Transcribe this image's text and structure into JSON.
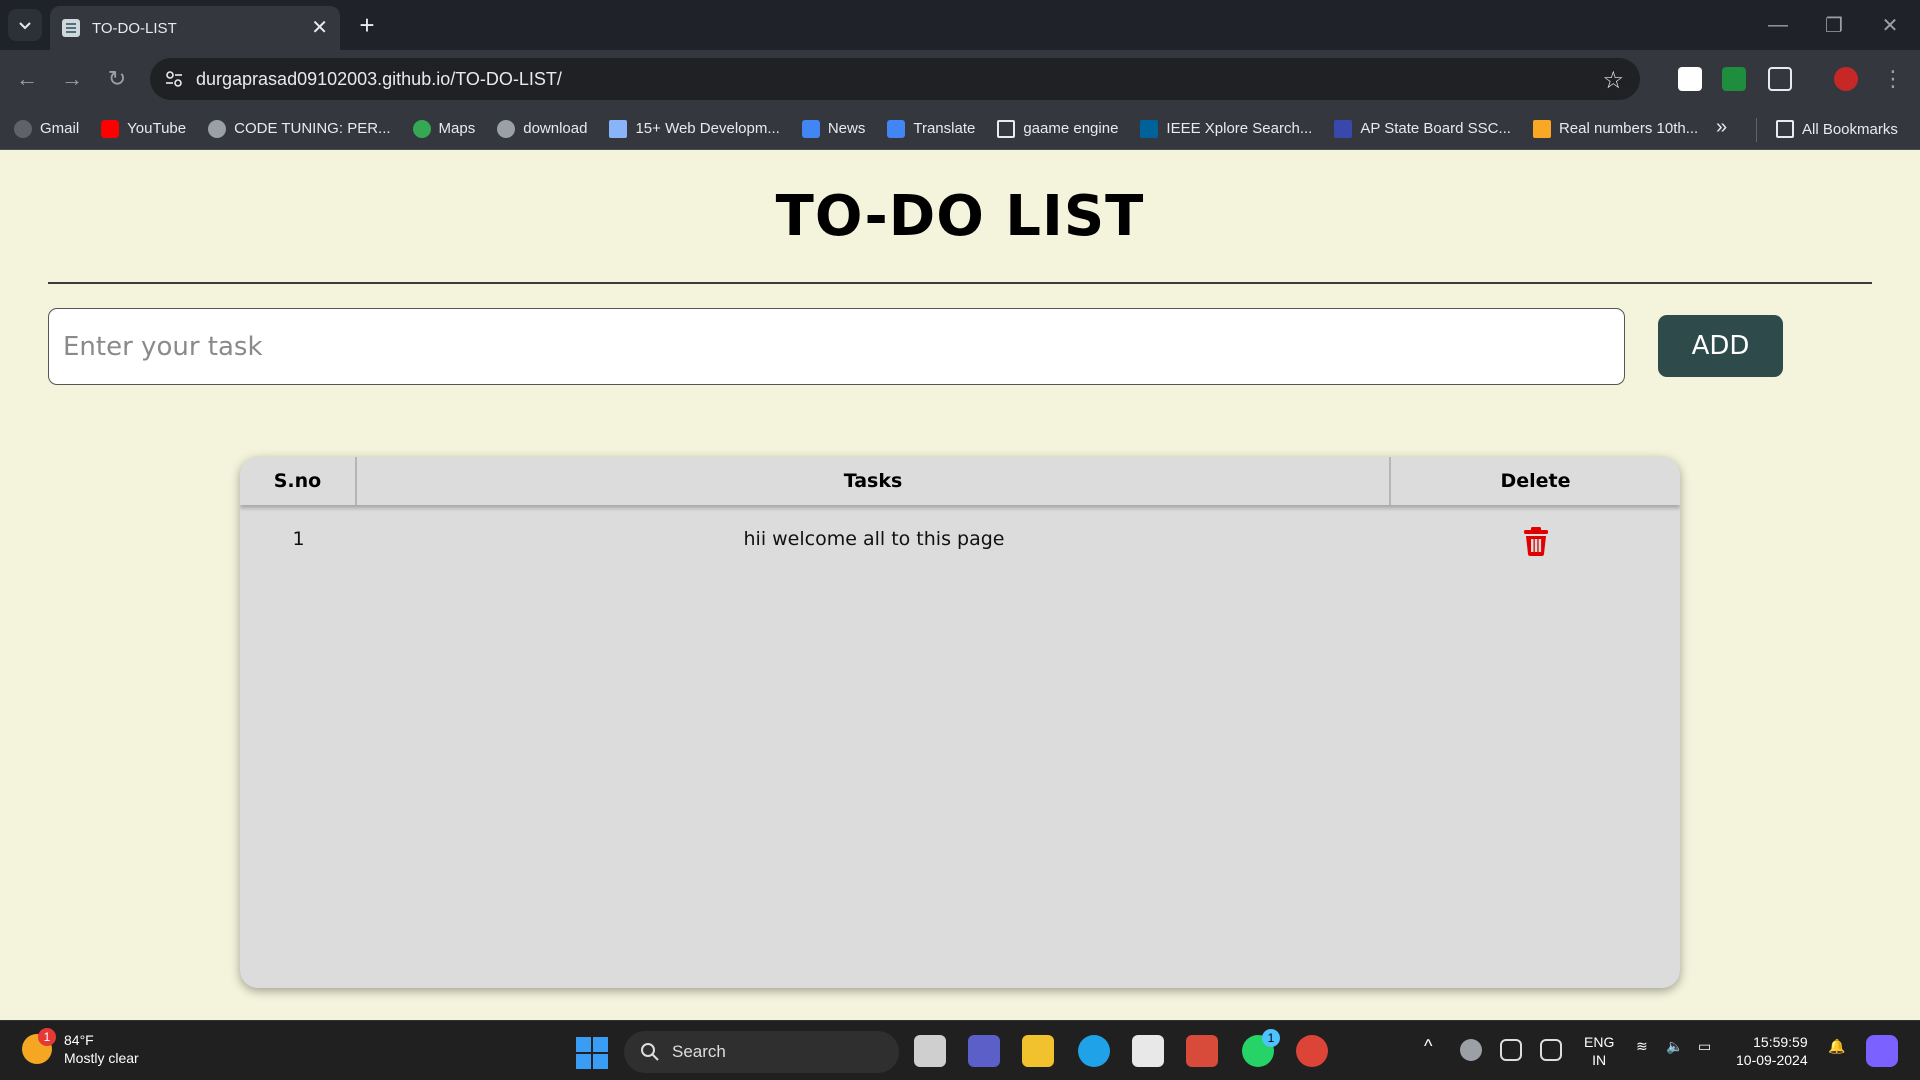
{
  "browser": {
    "tab_title": "TO-DO-LIST",
    "url": "durgaprasad09102003.github.io/TO-DO-LIST/",
    "bookmarks": [
      {
        "label": "Gmail",
        "color": "#5f6368"
      },
      {
        "label": "YouTube",
        "color": "#ff0000"
      },
      {
        "label": "CODE TUNING: PER...",
        "color": "#9aa0a6"
      },
      {
        "label": "Maps",
        "color": "#34a853"
      },
      {
        "label": "download",
        "color": "#9aa0a6"
      },
      {
        "label": "15+ Web Developm...",
        "color": "#8ab4f8"
      },
      {
        "label": "News",
        "color": "#4285f4"
      },
      {
        "label": "Translate",
        "color": "#4285f4"
      },
      {
        "label": "gaame engine",
        "color": "#e8eaed"
      },
      {
        "label": "IEEE Xplore Search...",
        "color": "#00629b"
      },
      {
        "label": "AP State Board SSC...",
        "color": "#3949ab"
      },
      {
        "label": "Real numbers 10th...",
        "color": "#f9a825"
      }
    ],
    "all_bookmarks": "All Bookmarks"
  },
  "page": {
    "title": "TO-DO LIST",
    "input_placeholder": "Enter your task",
    "add_label": "ADD",
    "table": {
      "headers": [
        "S.no",
        "Tasks",
        "Delete"
      ],
      "rows": [
        {
          "sno": "1",
          "task": "hii welcome all to this page"
        }
      ]
    },
    "colors": {
      "background": "#f4f4dc",
      "add_button": "#2e4a4a",
      "table": "#dcdcdc",
      "delete_icon": "#e00000"
    }
  },
  "taskbar": {
    "weather_temp": "84°F",
    "weather_desc": "Mostly clear",
    "weather_badge": "1",
    "search_label": "Search",
    "lang_top": "ENG",
    "lang_bottom": "IN",
    "time": "15:59:59",
    "date": "10-09-2024",
    "whatsapp_badge": "1"
  }
}
